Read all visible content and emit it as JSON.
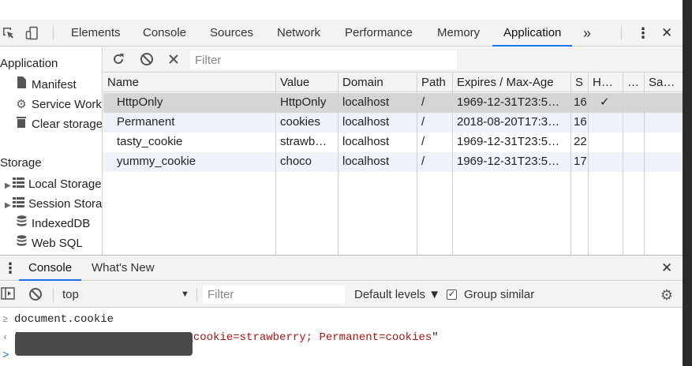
{
  "toolbar": {
    "tabs": [
      "Elements",
      "Console",
      "Sources",
      "Network",
      "Performance",
      "Memory",
      "Application"
    ],
    "active_tab": "Application",
    "more_label": "»",
    "menu_label": "⋮",
    "close_label": "✕"
  },
  "sidebar": {
    "section_application": "Application",
    "app_items": [
      {
        "label": "Manifest",
        "icon": "file-icon"
      },
      {
        "label": "Service Workers",
        "icon": "gear-icon"
      },
      {
        "label": "Clear storage",
        "icon": "trash-icon"
      }
    ],
    "section_storage": "Storage",
    "storage_items": [
      {
        "label": "Local Storage",
        "icon": "grid-icon"
      },
      {
        "label": "Session Storage",
        "icon": "grid-icon"
      },
      {
        "label": "IndexedDB",
        "icon": "database-icon"
      },
      {
        "label": "Web SQL",
        "icon": "database-icon"
      }
    ]
  },
  "cookies": {
    "filter_placeholder": "Filter",
    "columns": [
      "Name",
      "Value",
      "Domain",
      "Path",
      "Expires / Max-Age",
      "S",
      "H…",
      "…",
      "Sa…"
    ],
    "rows": [
      {
        "name": "HttpOnly",
        "value": "HttpOnly",
        "domain": "localhost",
        "path": "/",
        "expires": "1969-12-31T23:5…",
        "size": "16",
        "httponly": "✓"
      },
      {
        "name": "Permanent",
        "value": "cookies",
        "domain": "localhost",
        "path": "/",
        "expires": "2018-08-20T17:3…",
        "size": "16",
        "httponly": ""
      },
      {
        "name": "tasty_cookie",
        "value": "strawb…",
        "domain": "localhost",
        "path": "/",
        "expires": "1969-12-31T23:5…",
        "size": "22",
        "httponly": ""
      },
      {
        "name": "yummy_cookie",
        "value": "choco",
        "domain": "localhost",
        "path": "/",
        "expires": "1969-12-31T23:5…",
        "size": "17",
        "httponly": ""
      }
    ]
  },
  "drawer": {
    "tabs": [
      "Console",
      "What's New"
    ],
    "active_tab": "Console",
    "context": "top",
    "filter_placeholder": "Filter",
    "levels": "Default levels ▼",
    "group_similar": "Group similar",
    "group_similar_checked": true,
    "input_line": "document.cookie",
    "output_line": "yummy_cookie=choco; tasty_cookie=strawberry; Permanent=cookies"
  },
  "colors": {
    "accent": "#1a73e8",
    "string": "#a31515",
    "selected_row": "#d5d5d5",
    "alt_row": "#eef3fb"
  }
}
